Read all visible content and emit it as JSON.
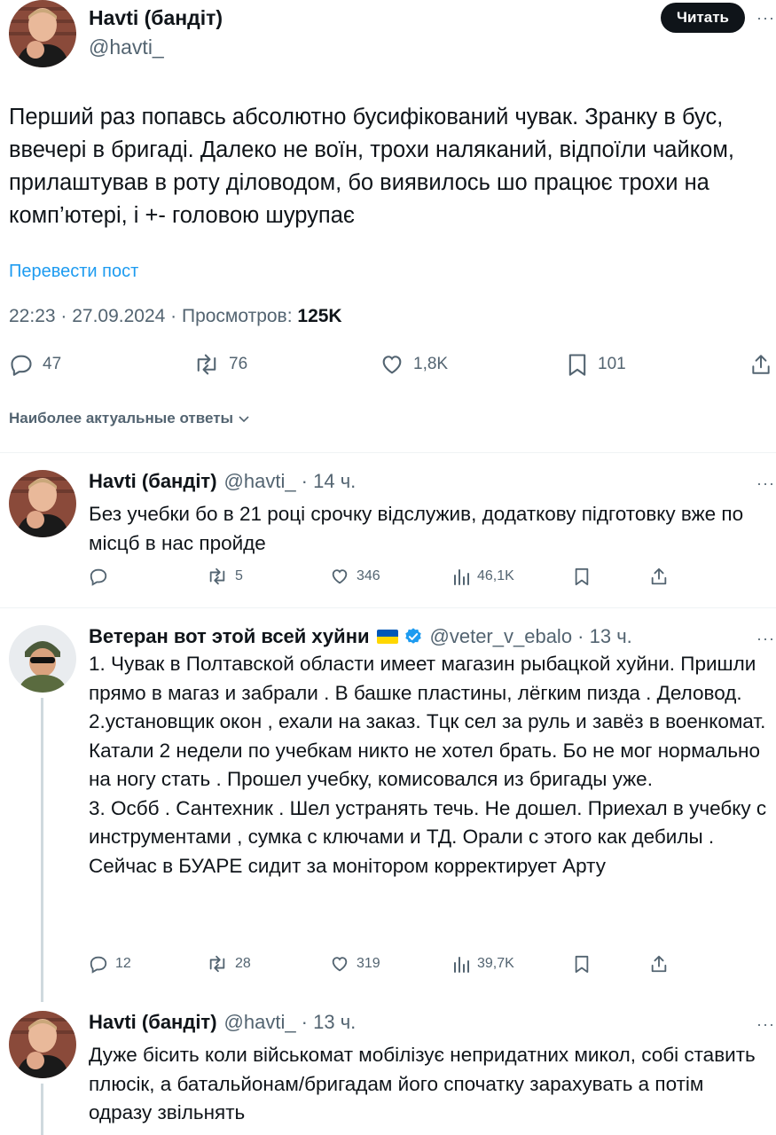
{
  "main": {
    "name": "Havti (бандіт)",
    "handle": "@havti_",
    "follow_label": "Читать",
    "more": "···",
    "text": "Перший раз попавсь абсолютно бусифікований чувак. Зранку в бус, ввечері в бригаді. Далеко не воїн, трохи наляканий, відпоїли чайком, прилаштував в роту діловодом, бо виявилось шо працює трохи на комп’ютері, і +- головою шурупає",
    "translate": "Перевести пост",
    "meta_prefix": "22:23 · 27.09.2024 · Просмотров: ",
    "views": "125K",
    "stats": {
      "replies": "47",
      "retweets": "76",
      "likes": "1,8K",
      "bookmarks": "101"
    }
  },
  "sort_label": "Наиболее актуальные ответы",
  "replies": [
    {
      "name": "Havti (бандіт)",
      "handle": "@havti_ · 14 ч.",
      "more": "···",
      "text": "Без учебки бо в 21 році срочку відслужив, додаткову підготовку вже по місцб в нас пройде",
      "stats": {
        "replies": "",
        "retweets": "5",
        "likes": "346",
        "views": "46,1K"
      }
    },
    {
      "name": "Ветеран вот этой всей хуйни",
      "handle": "@veter_v_ebalo · 13 ч.",
      "more": "···",
      "lines": [
        "1. Чувак в Полтавской области имеет магазин рыбацкой хуйни. Пришли прямо в магаз и забрали . В башке пластины, лёгким пизда . Деловод.",
        "2.установщик окон , ехали на заказ. Тцк сел за руль и завёз в военкомат. Катали 2 недели по учебкам  никто не хотел брать.  Бо не мог нормально на ногу стать . Прошел учебку, комисовался из бригады уже.",
        "3. Осбб . Сантехник . Шел  устранять течь.  Не дошел. Приехал в учебку с инструментами , сумка с ключами и ТД. Орали с этого как дебилы . Сейчас в БУАРЕ сидит за монітором корректирует Арту"
      ],
      "stats": {
        "replies": "12",
        "retweets": "28",
        "likes": "319",
        "views": "39,7K"
      },
      "flag_colors": [
        "#0057b7",
        "#ffd700"
      ],
      "verified_color": "#1d9bf0"
    },
    {
      "name": "Havti (бандіт)",
      "handle": "@havti_ · 13 ч.",
      "more": "···",
      "text": "Дуже бісить коли військомат мобілізує непридатних микол, собі ставить плюсік, а батальйонам/бригадам його спочатку зарахувать а потім одразу звільнять"
    }
  ]
}
